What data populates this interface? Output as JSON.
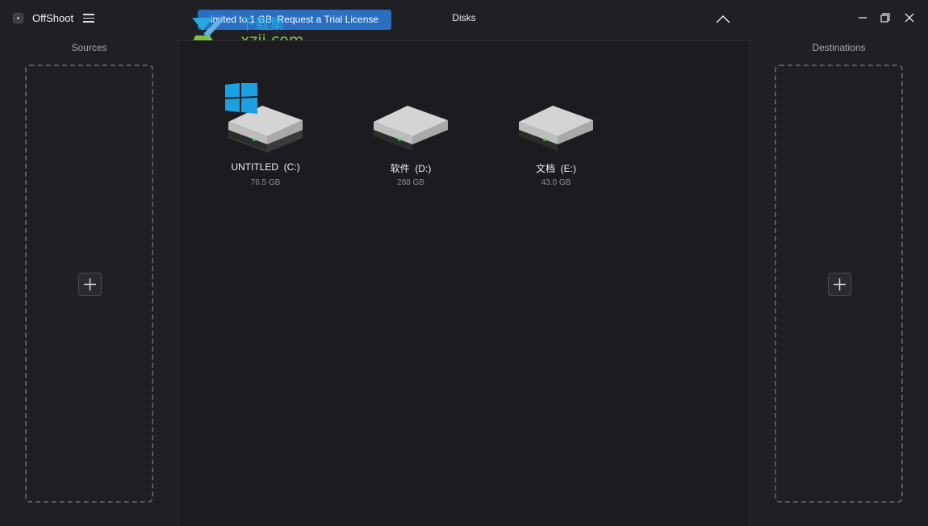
{
  "app": {
    "title": "OffShoot"
  },
  "header": {
    "trial_button_label": "imited to 1 GB. Request a Trial License",
    "center_title": "Disks"
  },
  "watermark": {
    "line1": "下载集",
    "line2": "xzji.com"
  },
  "sources": {
    "heading": "Sources"
  },
  "destinations": {
    "heading": "Destinations"
  },
  "disks": [
    {
      "name": "UNTITLED  (C:)",
      "size": "76.5 GB",
      "system": true
    },
    {
      "name": "软件  (D:)",
      "size": "288 GB",
      "system": false
    },
    {
      "name": "文档  (E:)",
      "size": "43.0 GB",
      "system": false
    }
  ],
  "colors": {
    "accent": "#2b6fc0",
    "windows_logo": "#1ba1e2",
    "led": "#3fd94b"
  }
}
